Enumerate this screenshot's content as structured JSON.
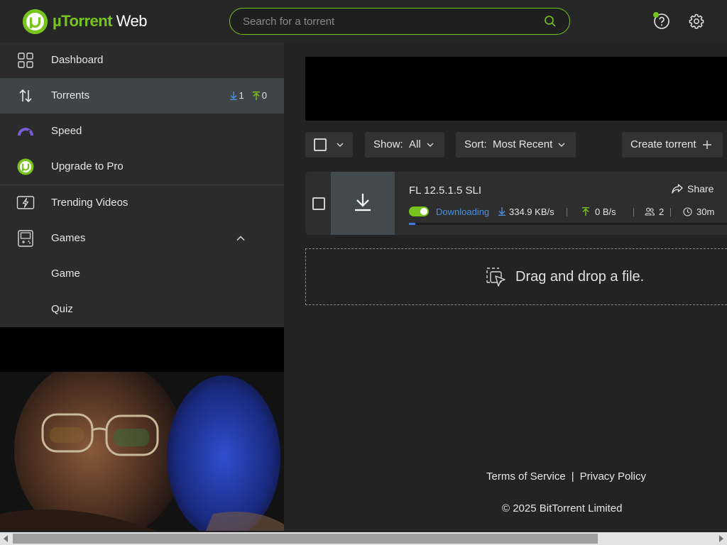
{
  "app": {
    "logo_brand": "µTorrent",
    "logo_suffix": " Web"
  },
  "search": {
    "placeholder": "Search for a torrent"
  },
  "header_icons": [
    "help-icon",
    "gear-icon"
  ],
  "sidebar": {
    "items": [
      {
        "label": "Dashboard",
        "icon": "dashboard-icon"
      },
      {
        "label": "Torrents",
        "icon": "transfer-arrows-icon",
        "down_count": "1",
        "up_count": "0"
      },
      {
        "label": "Speed",
        "icon": "speedometer-icon"
      },
      {
        "label": "Upgrade to Pro",
        "icon": "utorrent-logo-icon"
      },
      {
        "label": "Trending Videos",
        "icon": "lightning-video-icon"
      },
      {
        "label": "Games",
        "icon": "gamepad-icon"
      },
      {
        "label": "Game"
      },
      {
        "label": "Quiz"
      }
    ]
  },
  "toolbar": {
    "show_label": "Show:",
    "show_value": "All",
    "sort_label": "Sort:",
    "sort_value": "Most Recent",
    "create_label": "Create torrent"
  },
  "torrent": {
    "name": "FL 12.5.1.5 SLI",
    "share_label": "Share",
    "status": "Downloading",
    "download_speed": "334.9 KB/s",
    "upload_speed": "0 B/s",
    "peers": "2",
    "eta": "30m",
    "progress_fraction": 0.02
  },
  "dropzone": {
    "text": "Drag and drop a file."
  },
  "footer": {
    "terms": "Terms of Service",
    "separator": "|",
    "privacy": "Privacy Policy",
    "copyright": "© 2025 BitTorrent Limited"
  },
  "colors": {
    "accent_green": "#78c41e",
    "accent_blue": "#4a8fe0",
    "background": "#222222",
    "sidebar": "#2b2b2b"
  }
}
